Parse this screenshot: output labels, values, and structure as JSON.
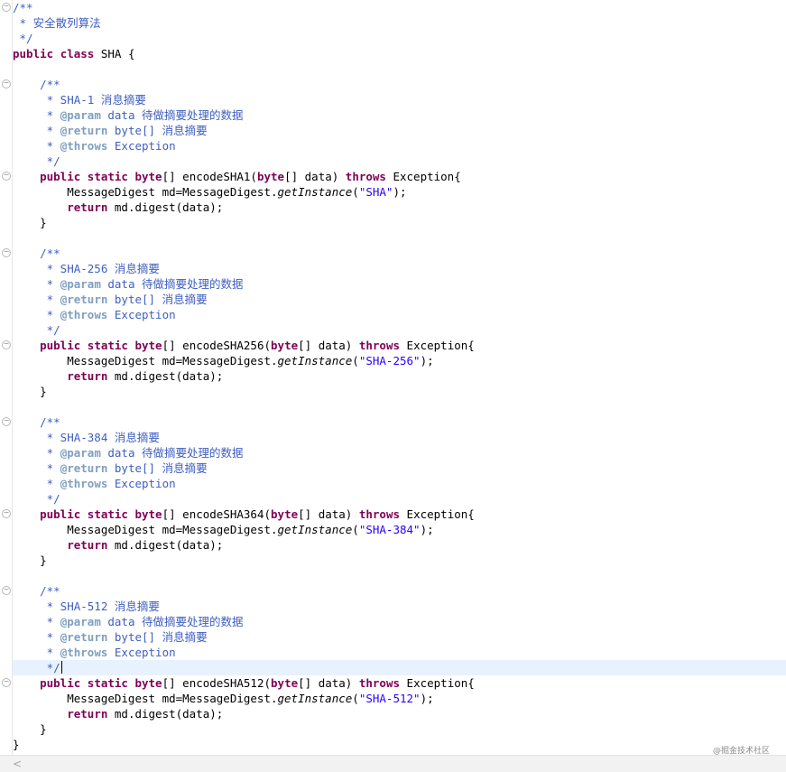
{
  "editor": {
    "lines": [
      {
        "fold": true,
        "segs": [
          {
            "t": "/**",
            "c": "jd"
          }
        ]
      },
      {
        "segs": [
          {
            "t": " * 安全散列算法",
            "c": "jd"
          }
        ]
      },
      {
        "segs": [
          {
            "t": " */",
            "c": "jd"
          }
        ]
      },
      {
        "segs": [
          {
            "t": "public",
            "c": "kw"
          },
          {
            "t": " "
          },
          {
            "t": "class",
            "c": "kw"
          },
          {
            "t": " SHA {"
          }
        ]
      },
      {
        "segs": []
      },
      {
        "fold": true,
        "segs": [
          {
            "t": "    "
          },
          {
            "t": "/**",
            "c": "jd"
          }
        ]
      },
      {
        "segs": [
          {
            "t": "     * SHA-1 消息摘要",
            "c": "jd"
          }
        ]
      },
      {
        "segs": [
          {
            "t": "     * ",
            "c": "jd"
          },
          {
            "t": "@param",
            "c": "jt"
          },
          {
            "t": " data 待做摘要处理的数据",
            "c": "jd"
          }
        ]
      },
      {
        "segs": [
          {
            "t": "     * ",
            "c": "jd"
          },
          {
            "t": "@return",
            "c": "jt"
          },
          {
            "t": " byte[] 消息摘要",
            "c": "jd"
          }
        ]
      },
      {
        "segs": [
          {
            "t": "     * ",
            "c": "jd"
          },
          {
            "t": "@throws",
            "c": "jt"
          },
          {
            "t": " Exception",
            "c": "jd"
          }
        ]
      },
      {
        "segs": [
          {
            "t": "     */",
            "c": "jd"
          }
        ]
      },
      {
        "fold": true,
        "segs": [
          {
            "t": "    "
          },
          {
            "t": "public",
            "c": "kw"
          },
          {
            "t": " "
          },
          {
            "t": "static",
            "c": "kw"
          },
          {
            "t": " "
          },
          {
            "t": "byte",
            "c": "kw"
          },
          {
            "t": "[] encodeSHA1("
          },
          {
            "t": "byte",
            "c": "kw"
          },
          {
            "t": "[] data) "
          },
          {
            "t": "throws",
            "c": "kw"
          },
          {
            "t": " Exception{"
          }
        ]
      },
      {
        "segs": [
          {
            "t": "        MessageDigest md=MessageDigest."
          },
          {
            "t": "getInstance",
            "c": "it"
          },
          {
            "t": "("
          },
          {
            "t": "\"SHA\"",
            "c": "str"
          },
          {
            "t": ");"
          }
        ]
      },
      {
        "segs": [
          {
            "t": "        "
          },
          {
            "t": "return",
            "c": "kw"
          },
          {
            "t": " md.digest(data);"
          }
        ]
      },
      {
        "segs": [
          {
            "t": "    }"
          }
        ]
      },
      {
        "segs": []
      },
      {
        "fold": true,
        "segs": [
          {
            "t": "    "
          },
          {
            "t": "/**",
            "c": "jd"
          }
        ]
      },
      {
        "segs": [
          {
            "t": "     * SHA-256 消息摘要",
            "c": "jd"
          }
        ]
      },
      {
        "segs": [
          {
            "t": "     * ",
            "c": "jd"
          },
          {
            "t": "@param",
            "c": "jt"
          },
          {
            "t": " data 待做摘要处理的数据",
            "c": "jd"
          }
        ]
      },
      {
        "segs": [
          {
            "t": "     * ",
            "c": "jd"
          },
          {
            "t": "@return",
            "c": "jt"
          },
          {
            "t": " byte[] 消息摘要",
            "c": "jd"
          }
        ]
      },
      {
        "segs": [
          {
            "t": "     * ",
            "c": "jd"
          },
          {
            "t": "@throws",
            "c": "jt"
          },
          {
            "t": " Exception",
            "c": "jd"
          }
        ]
      },
      {
        "segs": [
          {
            "t": "     */",
            "c": "jd"
          }
        ]
      },
      {
        "fold": true,
        "segs": [
          {
            "t": "    "
          },
          {
            "t": "public",
            "c": "kw"
          },
          {
            "t": " "
          },
          {
            "t": "static",
            "c": "kw"
          },
          {
            "t": " "
          },
          {
            "t": "byte",
            "c": "kw"
          },
          {
            "t": "[] encodeSHA256("
          },
          {
            "t": "byte",
            "c": "kw"
          },
          {
            "t": "[] data) "
          },
          {
            "t": "throws",
            "c": "kw"
          },
          {
            "t": " Exception{"
          }
        ]
      },
      {
        "segs": [
          {
            "t": "        MessageDigest md=MessageDigest."
          },
          {
            "t": "getInstance",
            "c": "it"
          },
          {
            "t": "("
          },
          {
            "t": "\"SHA-256\"",
            "c": "str"
          },
          {
            "t": ");"
          }
        ]
      },
      {
        "segs": [
          {
            "t": "        "
          },
          {
            "t": "return",
            "c": "kw"
          },
          {
            "t": " md.digest(data);"
          }
        ]
      },
      {
        "segs": [
          {
            "t": "    }"
          }
        ]
      },
      {
        "segs": []
      },
      {
        "fold": true,
        "segs": [
          {
            "t": "    "
          },
          {
            "t": "/**",
            "c": "jd"
          }
        ]
      },
      {
        "segs": [
          {
            "t": "     * SHA-384 消息摘要",
            "c": "jd"
          }
        ]
      },
      {
        "segs": [
          {
            "t": "     * ",
            "c": "jd"
          },
          {
            "t": "@param",
            "c": "jt"
          },
          {
            "t": " data 待做摘要处理的数据",
            "c": "jd"
          }
        ]
      },
      {
        "segs": [
          {
            "t": "     * ",
            "c": "jd"
          },
          {
            "t": "@return",
            "c": "jt"
          },
          {
            "t": " byte[] 消息摘要",
            "c": "jd"
          }
        ]
      },
      {
        "segs": [
          {
            "t": "     * ",
            "c": "jd"
          },
          {
            "t": "@throws",
            "c": "jt"
          },
          {
            "t": " Exception",
            "c": "jd"
          }
        ]
      },
      {
        "segs": [
          {
            "t": "     */",
            "c": "jd"
          }
        ]
      },
      {
        "fold": true,
        "segs": [
          {
            "t": "    "
          },
          {
            "t": "public",
            "c": "kw"
          },
          {
            "t": " "
          },
          {
            "t": "static",
            "c": "kw"
          },
          {
            "t": " "
          },
          {
            "t": "byte",
            "c": "kw"
          },
          {
            "t": "[] encodeSHA364("
          },
          {
            "t": "byte",
            "c": "kw"
          },
          {
            "t": "[] data) "
          },
          {
            "t": "throws",
            "c": "kw"
          },
          {
            "t": " Exception{"
          }
        ]
      },
      {
        "segs": [
          {
            "t": "        MessageDigest md=MessageDigest."
          },
          {
            "t": "getInstance",
            "c": "it"
          },
          {
            "t": "("
          },
          {
            "t": "\"SHA-384\"",
            "c": "str"
          },
          {
            "t": ");"
          }
        ]
      },
      {
        "segs": [
          {
            "t": "        "
          },
          {
            "t": "return",
            "c": "kw"
          },
          {
            "t": " md.digest(data);"
          }
        ]
      },
      {
        "segs": [
          {
            "t": "    }"
          }
        ]
      },
      {
        "segs": []
      },
      {
        "fold": true,
        "segs": [
          {
            "t": "    "
          },
          {
            "t": "/**",
            "c": "jd"
          }
        ]
      },
      {
        "segs": [
          {
            "t": "     * SHA-512 消息摘要",
            "c": "jd"
          }
        ]
      },
      {
        "segs": [
          {
            "t": "     * ",
            "c": "jd"
          },
          {
            "t": "@param",
            "c": "jt"
          },
          {
            "t": " data 待做摘要处理的数据",
            "c": "jd"
          }
        ]
      },
      {
        "segs": [
          {
            "t": "     * ",
            "c": "jd"
          },
          {
            "t": "@return",
            "c": "jt"
          },
          {
            "t": " byte[] 消息摘要",
            "c": "jd"
          }
        ]
      },
      {
        "segs": [
          {
            "t": "     * ",
            "c": "jd"
          },
          {
            "t": "@throws",
            "c": "jt"
          },
          {
            "t": " Exception",
            "c": "jd"
          }
        ]
      },
      {
        "current": true,
        "caret": true,
        "segs": [
          {
            "t": "     */",
            "c": "jd"
          }
        ]
      },
      {
        "fold": true,
        "segs": [
          {
            "t": "    "
          },
          {
            "t": "public",
            "c": "kw"
          },
          {
            "t": " "
          },
          {
            "t": "static",
            "c": "kw"
          },
          {
            "t": " "
          },
          {
            "t": "byte",
            "c": "kw"
          },
          {
            "t": "[] encodeSHA512("
          },
          {
            "t": "byte",
            "c": "kw"
          },
          {
            "t": "[] data) "
          },
          {
            "t": "throws",
            "c": "kw"
          },
          {
            "t": " Exception{"
          }
        ]
      },
      {
        "segs": [
          {
            "t": "        MessageDigest md=MessageDigest."
          },
          {
            "t": "getInstance",
            "c": "it"
          },
          {
            "t": "("
          },
          {
            "t": "\"SHA-512\"",
            "c": "str"
          },
          {
            "t": ");"
          }
        ]
      },
      {
        "segs": [
          {
            "t": "        "
          },
          {
            "t": "return",
            "c": "kw"
          },
          {
            "t": " md.digest(data);"
          }
        ]
      },
      {
        "segs": [
          {
            "t": "    }"
          }
        ]
      },
      {
        "segs": [
          {
            "t": "}"
          }
        ]
      }
    ]
  },
  "scrollbar": {
    "left_arrow": "<"
  },
  "watermark": "@掘金技术社区",
  "colors": {
    "keyword": "#7f0055",
    "javadoc": "#3f5fbf",
    "javadoc_tag": "#7f9fbf",
    "string": "#2a00ff",
    "current_line": "#e8f2fe"
  }
}
